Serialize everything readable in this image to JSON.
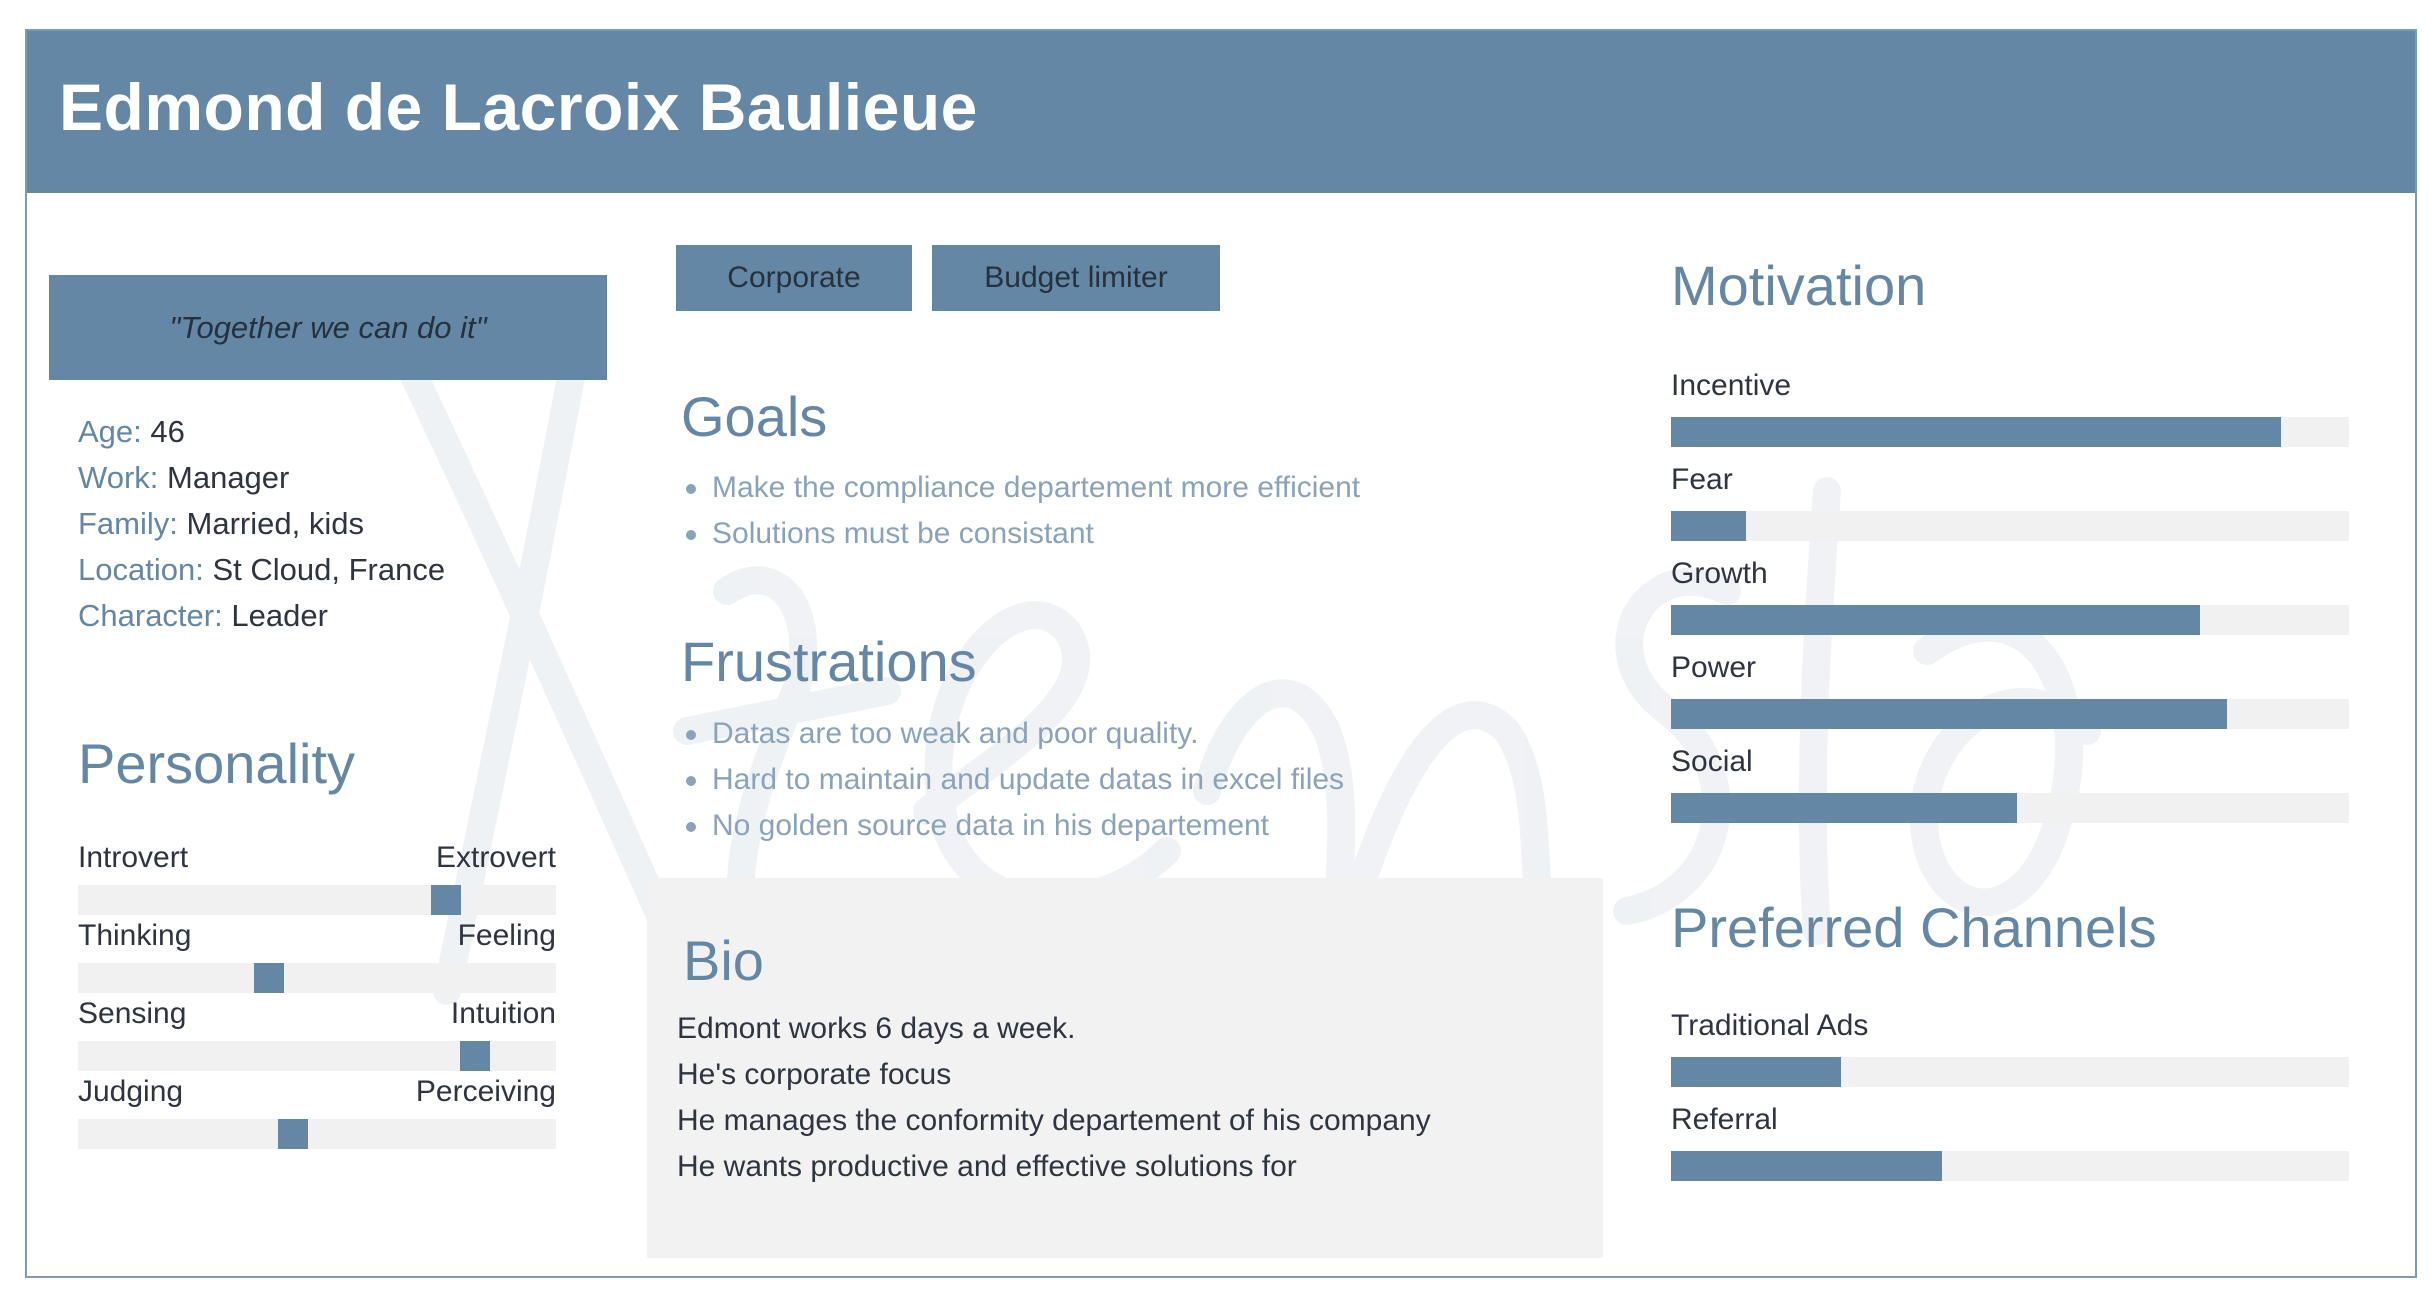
{
  "persona": {
    "name": "Edmond de Lacroix Baulieue",
    "quote": "\"Together we can do it\"",
    "facts": [
      {
        "label": "Age:",
        "value": "46"
      },
      {
        "label": "Work:",
        "value": "Manager"
      },
      {
        "label": "Family:",
        "value": "Married, kids"
      },
      {
        "label": "Location:",
        "value": "St Cloud, France"
      },
      {
        "label": "Character:",
        "value": "Leader"
      }
    ]
  },
  "personality": {
    "title": "Personality",
    "traits": [
      {
        "left": "Introvert",
        "right": "Extrovert",
        "level": 0.77
      },
      {
        "left": "Thinking",
        "right": "Feeling",
        "level": 0.4
      },
      {
        "left": "Sensing",
        "right": "Intuition",
        "level": 0.83
      },
      {
        "left": "Judging",
        "right": "Perceiving",
        "level": 0.45
      }
    ]
  },
  "tags": [
    "Corporate",
    "Budget limiter"
  ],
  "goals": {
    "title": "Goals",
    "items": [
      "Make the compliance departement more efficient",
      "Solutions must be consistant"
    ]
  },
  "frustrations": {
    "title": "Frustrations",
    "items": [
      "Datas are too weak and poor quality.",
      "Hard to maintain and update datas in excel files",
      "No golden source data in his departement"
    ]
  },
  "bio": {
    "title": "Bio",
    "lines": [
      "Edmont works 6 days a week.",
      "He's corporate focus",
      "He manages the conformity departement of his company",
      "He wants productive and effective solutions for"
    ]
  },
  "motivation": {
    "title": "Motivation",
    "items": [
      {
        "label": "Incentive",
        "level": 0.9
      },
      {
        "label": "Fear",
        "level": 0.11
      },
      {
        "label": "Growth",
        "level": 0.78
      },
      {
        "label": "Power",
        "level": 0.82
      },
      {
        "label": "Social",
        "level": 0.51
      }
    ]
  },
  "channels": {
    "title": "Preferred Channels",
    "items": [
      {
        "label": "Traditional Ads",
        "level": 0.25
      },
      {
        "label": "Referral",
        "level": 0.4
      }
    ]
  },
  "colors": {
    "accent": "#6487a6",
    "track": "#f1f1f1",
    "muted_text": "#8aa3ba"
  }
}
